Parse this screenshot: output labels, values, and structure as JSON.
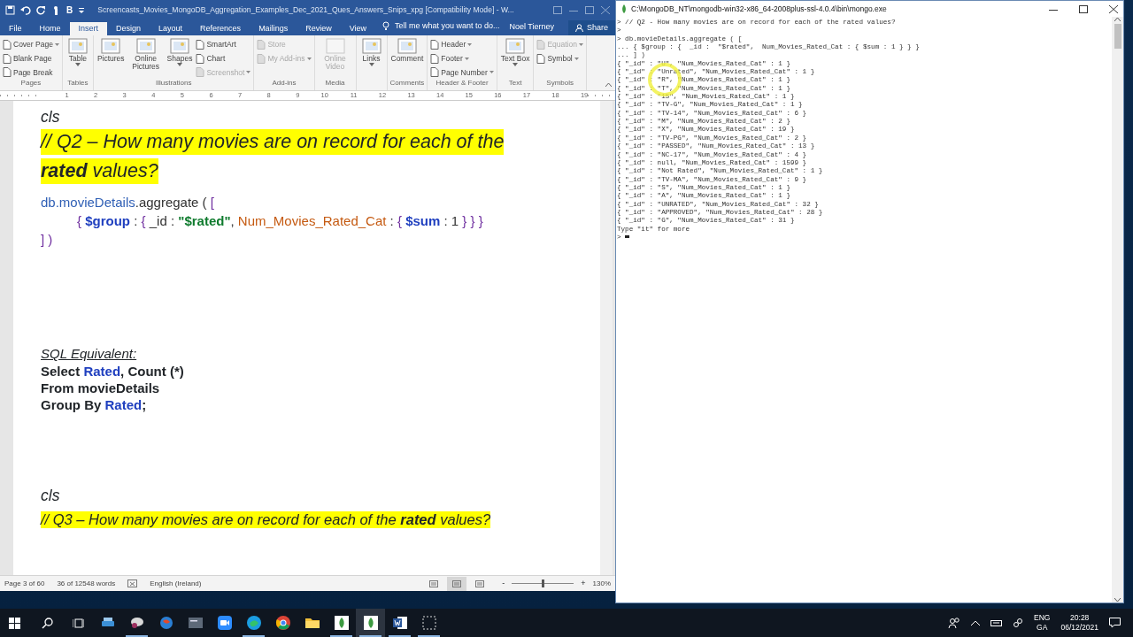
{
  "word": {
    "quick_access": [
      "B"
    ],
    "title": "Screencasts_Movies_MongoDB_Aggregation_Examples_Dec_2021_Ques_Answers_Snips_xpg [Compatibility Mode] - W...",
    "tabs": [
      {
        "label": "File",
        "selected": false
      },
      {
        "label": "Home",
        "selected": false
      },
      {
        "label": "Insert",
        "selected": true
      },
      {
        "label": "Design",
        "selected": false
      },
      {
        "label": "Layout",
        "selected": false
      },
      {
        "label": "References",
        "selected": false
      },
      {
        "label": "Mailings",
        "selected": false
      },
      {
        "label": "Review",
        "selected": false
      },
      {
        "label": "View",
        "selected": false
      }
    ],
    "tell_me": {
      "placeholder": "Tell me what you want to do..."
    },
    "user": "Noel Tierney",
    "share": "Share",
    "ribbon_groups": [
      {
        "label": "Pages",
        "items": [
          {
            "kind": "small",
            "label": "Cover Page",
            "dropdown": true,
            "disabled": false
          },
          {
            "kind": "small",
            "label": "Blank Page",
            "dropdown": false,
            "disabled": false
          },
          {
            "kind": "small",
            "label": "Page Break",
            "dropdown": false,
            "disabled": false
          }
        ]
      },
      {
        "label": "Tables",
        "items": [
          {
            "kind": "large",
            "label": "Table",
            "dropdown": true,
            "disabled": false
          }
        ]
      },
      {
        "label": "Illustrations",
        "items": [
          {
            "kind": "large",
            "label": "Pictures",
            "dropdown": false,
            "disabled": false
          },
          {
            "kind": "large",
            "label": "Online Pictures",
            "dropdown": false,
            "disabled": false
          },
          {
            "kind": "large",
            "label": "Shapes",
            "dropdown": true,
            "disabled": false
          },
          {
            "kind": "small",
            "label": "SmartArt",
            "dropdown": false,
            "disabled": false
          },
          {
            "kind": "small",
            "label": "Chart",
            "dropdown": false,
            "disabled": false
          },
          {
            "kind": "small",
            "label": "Screenshot",
            "dropdown": true,
            "disabled": true
          }
        ]
      },
      {
        "label": "Add-ins",
        "items": [
          {
            "kind": "small",
            "label": "Store",
            "dropdown": false,
            "disabled": true
          },
          {
            "kind": "small",
            "label": "My Add-ins",
            "dropdown": true,
            "disabled": true
          }
        ]
      },
      {
        "label": "Media",
        "items": [
          {
            "kind": "large",
            "label": "Online Video",
            "dropdown": false,
            "disabled": true
          }
        ]
      },
      {
        "items": [
          {
            "kind": "large",
            "label": "Links",
            "dropdown": true,
            "disabled": false
          }
        ]
      },
      {
        "label": "Comments",
        "items": [
          {
            "kind": "large",
            "label": "Comment",
            "dropdown": false,
            "disabled": false
          }
        ]
      },
      {
        "label": "Header & Footer",
        "items": [
          {
            "kind": "small",
            "label": "Header",
            "dropdown": true,
            "disabled": false
          },
          {
            "kind": "small",
            "label": "Footer",
            "dropdown": true,
            "disabled": false
          },
          {
            "kind": "small",
            "label": "Page Number",
            "dropdown": true,
            "disabled": false
          }
        ]
      },
      {
        "label": "Text",
        "items": [
          {
            "kind": "large",
            "label": "Text Box",
            "dropdown": true,
            "disabled": false
          }
        ]
      },
      {
        "label": "Symbols",
        "items": [
          {
            "kind": "small",
            "label": "Equation",
            "dropdown": true,
            "disabled": true
          },
          {
            "kind": "small",
            "label": "Symbol",
            "dropdown": true,
            "disabled": false
          }
        ]
      }
    ],
    "ruler": [
      "1",
      "2",
      "3",
      "4",
      "5",
      "6",
      "7",
      "8",
      "9",
      "10",
      "11",
      "12",
      "13",
      "14",
      "15",
      "16",
      "17",
      "18",
      "19"
    ],
    "document": [
      {
        "kind": "comment",
        "segments": [
          {
            "kind": "plain",
            "text": "cls"
          }
        ]
      },
      {
        "kind": "heading",
        "segments": [
          {
            "kind": "plain",
            "text": "// Q2 – How many movies are on record for each of the"
          }
        ]
      },
      {
        "kind": "heading",
        "segments": [
          {
            "kind": "bold",
            "text": "rated"
          },
          {
            "kind": "plain",
            "text": " values?"
          }
        ]
      },
      {
        "kind": "code",
        "segments": [
          {
            "kind": "object",
            "text": "db.movieDetails"
          },
          {
            "kind": "plain",
            "text": ".aggregate ( "
          },
          {
            "kind": "bracket",
            "text": "["
          }
        ]
      },
      {
        "kind": "code-indent",
        "segments": [
          {
            "kind": "bracket",
            "text": "{ "
          },
          {
            "kind": "operator",
            "text": "$group"
          },
          {
            "kind": "plain",
            "text": " : "
          },
          {
            "kind": "bracket",
            "text": "{ "
          },
          {
            "kind": "plain",
            "text": " _id :  "
          },
          {
            "kind": "string",
            "text": "\"$rated\""
          },
          {
            "kind": "plain",
            "text": ",  "
          },
          {
            "kind": "field",
            "text": "Num_Movies_Rated_Cat"
          },
          {
            "kind": "plain",
            "text": " : "
          },
          {
            "kind": "bracket",
            "text": "{ "
          },
          {
            "kind": "operator",
            "text": "$sum"
          },
          {
            "kind": "plain",
            "text": " : 1 "
          },
          {
            "kind": "bracket",
            "text": "} } }"
          }
        ]
      },
      {
        "kind": "code",
        "segments": [
          {
            "kind": "bracket",
            "text": "] )"
          }
        ]
      },
      {
        "kind": "sql-title",
        "segments": [
          {
            "kind": "plain",
            "text": "SQL Equivalent:"
          }
        ]
      },
      {
        "kind": "sql",
        "segments": [
          {
            "kind": "plain",
            "text": "Select "
          },
          {
            "kind": "object",
            "text": "Rated"
          },
          {
            "kind": "plain",
            "text": ", Count (*)"
          }
        ]
      },
      {
        "kind": "sql",
        "segments": [
          {
            "kind": "plain",
            "text": "From movieDetails"
          }
        ]
      },
      {
        "kind": "sql",
        "segments": [
          {
            "kind": "plain",
            "text": "Group By "
          },
          {
            "kind": "object",
            "text": "Rated"
          },
          {
            "kind": "plain",
            "text": ";"
          }
        ]
      },
      {
        "kind": "comment",
        "segments": [
          {
            "kind": "plain",
            "text": "cls"
          }
        ]
      },
      {
        "kind": "heading-small",
        "segments": [
          {
            "kind": "plain",
            "text": "// Q3 – How many movies are on record for each of the "
          },
          {
            "kind": "bold",
            "text": "rated"
          },
          {
            "kind": "plain",
            "text": " values?"
          }
        ]
      }
    ],
    "status": {
      "page": "Page 3 of 60",
      "words": "36 of 12548 words",
      "language": "English (Ireland)",
      "zoom": "130%",
      "zoom_out": "-",
      "zoom_in": "+",
      "zoom_slider": {
        "level": 0.5
      },
      "views": [
        {
          "selected": false
        },
        {
          "selected": true
        },
        {
          "selected": false
        }
      ]
    }
  },
  "console": {
    "title": "C:\\MongoDB_NT\\mongodb-win32-x86_64-2008plus-ssl-4.0.4\\bin\\mongo.exe",
    "lines": [
      "> // Q2 - How many movies are on record for each of the rated values?",
      ">",
      "> db.movieDetails.aggregate ( [",
      "... { $group : {  _id :  \"$rated\",  Num_Movies_Rated_Cat : { $sum : 1 } } }",
      "... ] )",
      "{ \"_id\" : \"U\", \"Num_Movies_Rated_Cat\" : 1 }",
      "{ \"_id\" : \"Unrated\", \"Num_Movies_Rated_Cat\" : 1 }",
      "{ \"_id\" : \"R\", \"Num_Movies_Rated_Cat\" : 1 }",
      "{ \"_id\" : \"T\", \"Num_Movies_Rated_Cat\" : 1 }",
      "{ \"_id\" : \"15\", \"Num_Movies_Rated_Cat\" : 1 }",
      "{ \"_id\" : \"TV-G\", \"Num_Movies_Rated_Cat\" : 1 }",
      "{ \"_id\" : \"TV-14\", \"Num_Movies_Rated_Cat\" : 6 }",
      "{ \"_id\" : \"M\", \"Num_Movies_Rated_Cat\" : 2 }",
      "{ \"_id\" : \"X\", \"Num_Movies_Rated_Cat\" : 19 }",
      "{ \"_id\" : \"TV-PG\", \"Num_Movies_Rated_Cat\" : 2 }",
      "{ \"_id\" : \"PASSED\", \"Num_Movies_Rated_Cat\" : 13 }",
      "{ \"_id\" : \"NC-17\", \"Num_Movies_Rated_Cat\" : 4 }",
      "{ \"_id\" : null, \"Num_Movies_Rated_Cat\" : 1599 }",
      "{ \"_id\" : \"Not Rated\", \"Num_Movies_Rated_Cat\" : 1 }",
      "{ \"_id\" : \"TV-MA\", \"Num_Movies_Rated_Cat\" : 9 }",
      "{ \"_id\" : \"S\", \"Num_Movies_Rated_Cat\" : 1 }",
      "{ \"_id\" : \"A\", \"Num_Movies_Rated_Cat\" : 1 }",
      "{ \"_id\" : \"UNRATED\", \"Num_Movies_Rated_Cat\" : 32 }",
      "{ \"_id\" : \"APPROVED\", \"Num_Movies_Rated_Cat\" : 28 }",
      "{ \"_id\" : \"G\", \"Num_Movies_Rated_Cat\" : 31 }",
      "Type \"it\" for more",
      ">"
    ]
  },
  "taskbar": {
    "apps": [
      {
        "kind": "drive",
        "running": false,
        "selected": false
      },
      {
        "kind": "network",
        "running": true,
        "selected": false
      },
      {
        "kind": "globe",
        "running": false,
        "selected": false
      },
      {
        "kind": "terminal",
        "running": false,
        "selected": false
      },
      {
        "kind": "camera",
        "running": false,
        "selected": false
      },
      {
        "kind": "edge",
        "running": true,
        "selected": false
      },
      {
        "kind": "chrome",
        "running": false,
        "selected": false
      },
      {
        "kind": "folder",
        "running": false,
        "selected": false
      },
      {
        "kind": "leaf",
        "running": true,
        "selected": false
      },
      {
        "kind": "leaf",
        "running": true,
        "selected": true
      },
      {
        "kind": "word",
        "running": true,
        "selected": false
      },
      {
        "kind": "snip",
        "running": true,
        "selected": false
      }
    ],
    "language": [
      "ENG",
      "GA"
    ],
    "time": "20:28",
    "date": "06/12/2021"
  }
}
